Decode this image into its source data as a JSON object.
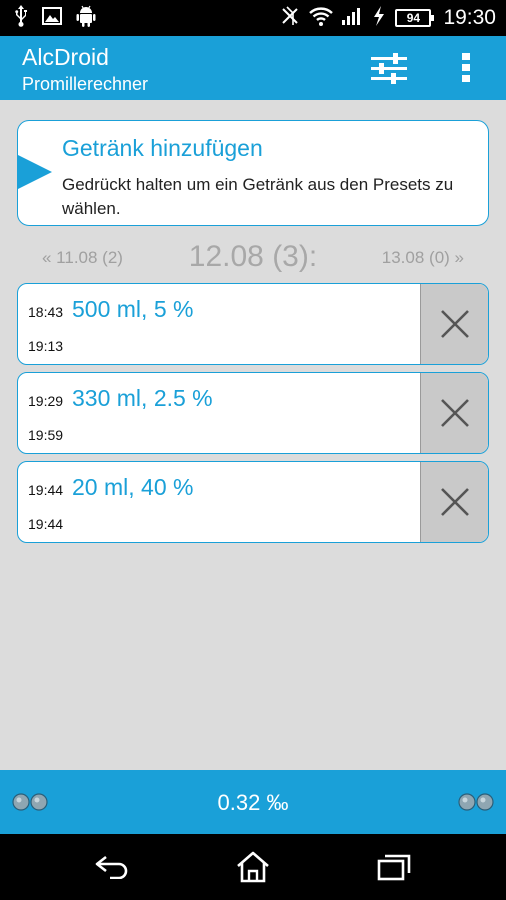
{
  "status_bar": {
    "icons_left": [
      "usb-icon",
      "image-icon",
      "android-icon"
    ],
    "icons_right": [
      "nfc-icon",
      "wifi-icon",
      "signal-icon",
      "no-sim-icon",
      "battery-icon"
    ],
    "battery": "94",
    "time": "19:30"
  },
  "action_bar": {
    "title": "AlcDroid",
    "subtitle": "Promillerechner",
    "filter_icon": "sliders-icon",
    "overflow_icon": "overflow-menu-icon"
  },
  "add_drink": {
    "title": "Getränk hinzufügen",
    "description": "Gedrückt halten um ein Getränk aus den Presets zu wählen."
  },
  "date_nav": {
    "prev": "« 11.08 (2)",
    "current": "12.08 (3):",
    "next": "13.08 (0) »"
  },
  "drinks": [
    {
      "start": "18:43",
      "end": "19:13",
      "amount": "500 ml, 5 %"
    },
    {
      "start": "19:29",
      "end": "19:59",
      "amount": "330 ml, 2.5 %"
    },
    {
      "start": "19:44",
      "end": "19:44",
      "amount": "20 ml, 40 %"
    }
  ],
  "bottom_bar": {
    "value": "0.32 ‰",
    "left_icon": "glasses-icon",
    "right_icon": "glasses-icon"
  },
  "colors": {
    "accent": "#1aa0d8",
    "background": "#dcdcdc",
    "delete_bg": "#c9c9c9"
  }
}
